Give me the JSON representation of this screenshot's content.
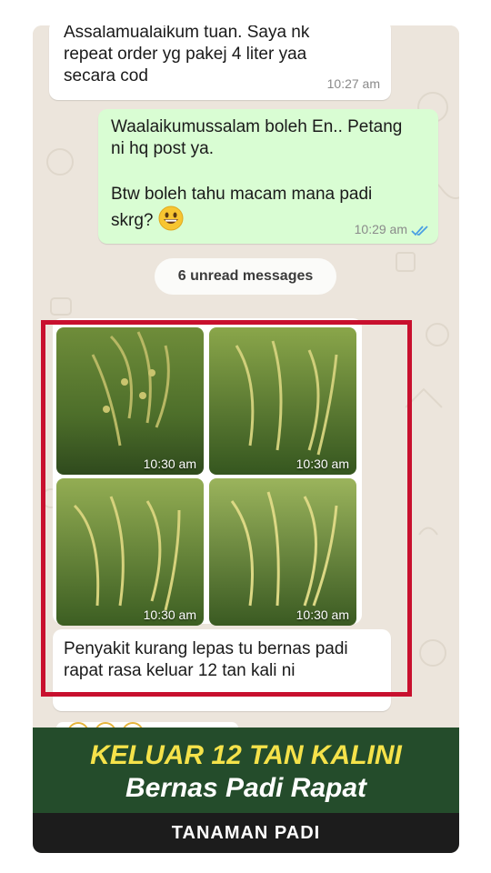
{
  "messages": {
    "m1": {
      "text": "Assalamualaikum tuan. Saya nk\nrepeat order yg pakej 4 liter yaa\nsecara cod",
      "time": "10:27 am"
    },
    "m2": {
      "text_a": "Waalaikumussalam boleh En.. Petang\nni hq post ya.",
      "text_b": "Btw boleh tahu macam mana padi\nskrg? ",
      "time": "10:29 am",
      "emoji": "grinning-face-icon",
      "ticks": "double-check-icon"
    },
    "unread": "6 unread messages",
    "photos": [
      {
        "time": "10:30 am"
      },
      {
        "time": "10:30 am"
      },
      {
        "time": "10:30 am"
      },
      {
        "time": "10:30 am"
      }
    ],
    "m3": {
      "text": "Penyakit kurang lepas tu bernas padi\nrapat rasa keluar 12 tan kali ni"
    }
  },
  "banner": {
    "line1": "KELUAR 12 TAN KALINI",
    "line2": "Bernas Padi Rapat",
    "footer": "TANAMAN PADI"
  },
  "colors": {
    "highlight": "#c8102e",
    "banner_green": "#244c2b",
    "headline_yellow": "#f5e24a",
    "out_bubble": "#d9fdd3"
  }
}
